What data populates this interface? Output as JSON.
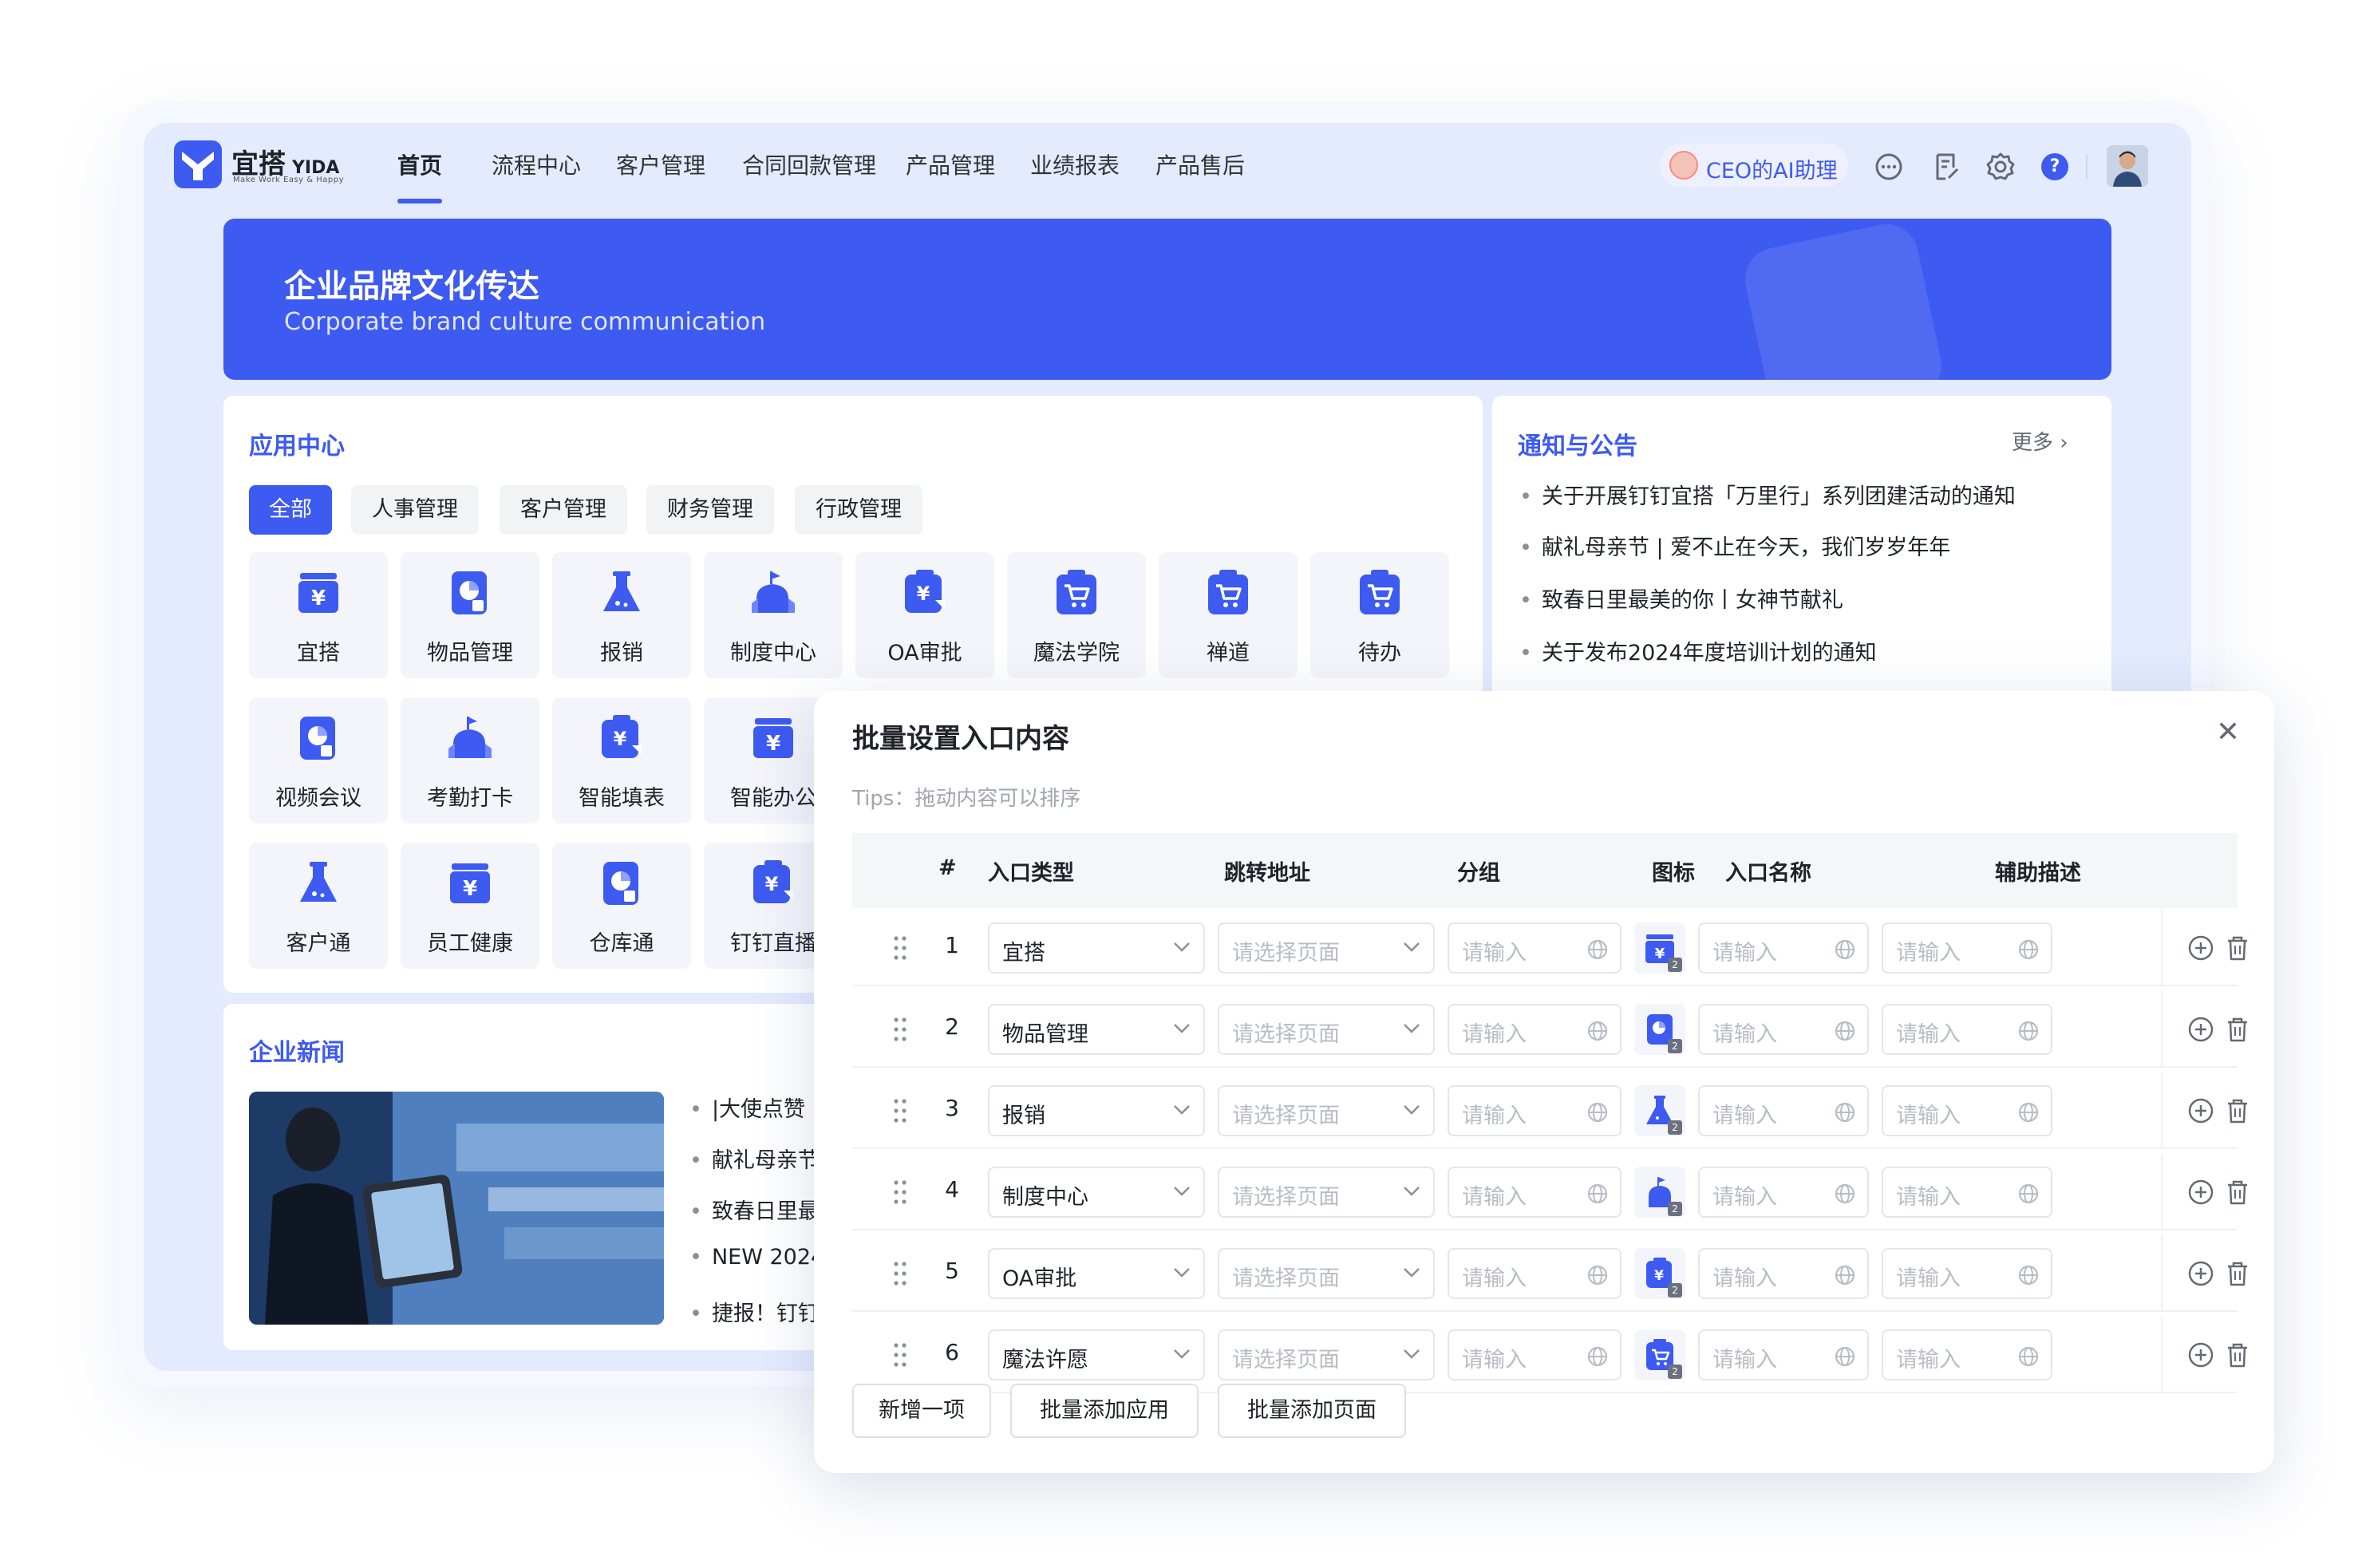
{
  "brand": {
    "name": "宜搭",
    "name_en": "YIDA",
    "slogan": "Make Work Easy & Happy",
    "accent": "#3d5af1"
  },
  "nav": {
    "items": [
      "首页",
      "流程中心",
      "客户管理",
      "合同回款管理",
      "产品管理",
      "业绩报表",
      "产品售后"
    ],
    "active": 0,
    "ai_assistant": "CEO的AI助理",
    "help": "?"
  },
  "banner": {
    "title": "企业品牌文化传达",
    "subtitle": "Corporate brand culture communication"
  },
  "app_center": {
    "title": "应用中心",
    "tabs": [
      "全部",
      "人事管理",
      "客户管理",
      "财务管理",
      "行政管理"
    ],
    "row1": [
      "宜搭",
      "物品管理",
      "报销",
      "制度中心",
      "OA审批",
      "魔法学院",
      "禅道",
      "待办"
    ],
    "row2": [
      "视频会议",
      "考勤打卡",
      "智能填表",
      "智能办公"
    ],
    "row3": [
      "客户通",
      "员工健康",
      "仓库通",
      "钉钉直播"
    ]
  },
  "notices": {
    "title": "通知与公告",
    "more": "更多",
    "items": [
      "关于开展钉钉宜搭「万里行」系列团建活动的通知",
      "献礼母亲节 | 爱不止在今天，我们岁岁年年",
      "致春日里最美的你丨女神节献礼",
      "关于发布2024年度培训计划的通知"
    ]
  },
  "news": {
    "title": "企业新闻",
    "items": [
      "|大使点赞",
      "献礼母亲节",
      "致春日里最",
      "NEW 2024",
      "捷报！钉钉"
    ]
  },
  "modal": {
    "title": "批量设置入口内容",
    "tips": "Tips：拖动内容可以排序",
    "headers": {
      "num": "#",
      "type": "入口类型",
      "url": "跳转地址",
      "group": "分组",
      "icon": "图标",
      "name": "入口名称",
      "desc": "辅助描述"
    },
    "placeholders": {
      "select_page": "请选择页面",
      "input": "请输入"
    },
    "rows": [
      {
        "n": "1",
        "type": "宜搭",
        "icon": "yen-bag-icon"
      },
      {
        "n": "2",
        "type": "物品管理",
        "icon": "pie-doc-icon"
      },
      {
        "n": "3",
        "type": "报销",
        "icon": "flask-icon"
      },
      {
        "n": "4",
        "type": "制度中心",
        "icon": "building-icon"
      },
      {
        "n": "5",
        "type": "OA审批",
        "icon": "yen-clipboard-icon"
      },
      {
        "n": "6",
        "type": "魔法许愿",
        "icon": "cart-icon"
      }
    ],
    "badge": "2",
    "buttons": {
      "add_one": "新增一项",
      "batch_app": "批量添加应用",
      "batch_page": "批量添加页面"
    }
  }
}
